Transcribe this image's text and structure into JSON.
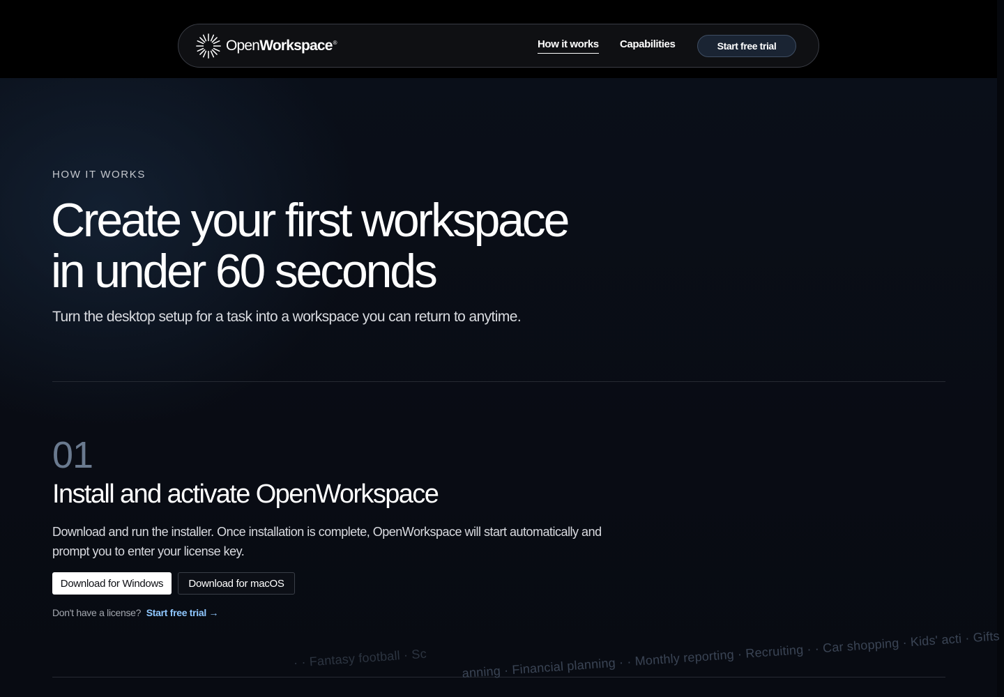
{
  "nav": {
    "logo_light": "Open",
    "logo_bold": "Workspace",
    "logo_mark": "®",
    "links": [
      {
        "label": "How it works",
        "active": true
      },
      {
        "label": "Capabilities",
        "active": false
      }
    ],
    "cta_label": "Start free trial"
  },
  "hero": {
    "eyebrow": "HOW IT WORKS",
    "title_line1": "Create your first workspace",
    "title_line2": "in under 60 seconds",
    "subtitle": "Turn the desktop setup for a task into a workspace you can return to anytime."
  },
  "step": {
    "number": "01",
    "title": "Install and activate OpenWorkspace",
    "description": "Download and run the installer. Once installation is complete, OpenWorkspace will start automatically and prompt you to enter your license key.",
    "download_windows": "Download for Windows",
    "download_macos": "Download for macOS",
    "license_prompt": "Don't have a license?",
    "trial_link": "Start free trial →"
  },
  "marquee": {
    "line1": "· · Fantasy football · Sc",
    "line2": "anning · Financial planning · · Monthly reporting · Recruiting · · Car shopping · Kids' acti · Gifts · Pitch prep"
  },
  "colors": {
    "background": "#090c14",
    "accent_link": "#8fc7ff",
    "step_number": "#6a7a8f"
  }
}
